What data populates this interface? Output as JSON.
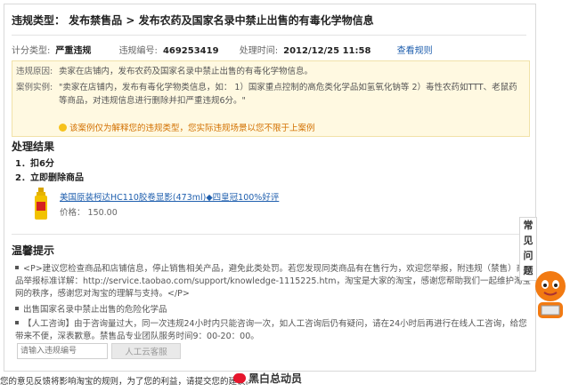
{
  "header": {
    "title": "违规类型： 发布禁售品 > 发布农药及国家名录中禁止出售的有毒化学物信息",
    "meta": {
      "score_type_label": "计分类型:",
      "score_type_value": "严重违规",
      "id_label": "违规编号:",
      "id_value": "469253419",
      "time_label": "处理时间:",
      "time_value": "2012/12/25 11:58",
      "rules_link": "查看规则"
    }
  },
  "reason": {
    "reason_label": "违规原因:",
    "reason_text": "卖家在店铺内，发布农药及国家名录中禁止出售的有毒化学物信息。",
    "example_label": "案例实例:",
    "example_text": "\"卖家在店铺内，发布有毒化学物类信息，如： 1）国家重点控制的高危类化学品如氢氧化钠等 2）毒性农药如TTT、老鼠药等商品，对违规信息进行删除并扣严重违规6分。\"",
    "tip": "该案例仅为解释您的违规类型，您实际违规场景以您不限于上案例"
  },
  "result": {
    "heading": "处理结果",
    "steps": [
      "1．扣6分",
      "2．立即删除商品"
    ],
    "product_name": "美国原装柯达HC110胶卷显影(473ml)◆四皇冠100%好评",
    "product_price": "价格： 150.00"
  },
  "tips": {
    "heading": "温馨提示",
    "items": [
      "<P>建议您检查商品和店铺信息，停止销售相关产品，避免此类处罚。若您发现同类商品有在售行为，欢迎您举报，附违规（禁售）商品举报标准详解：http://service.taobao.com/support/knowledge-1115225.htm，淘宝是大家的淘宝，感谢您帮助我们一起维护淘宝网的秩序，感谢您对淘宝的理解与支持。</P>",
      "出售国家名录中禁止出售的危险化学品",
      "【人工咨询】由于咨询量过大，同一次违规24小时内只能咨询一次，如人工咨询后仍有疑问，请在24小时后再进行在线人工咨询，给您带来不便，深表歉意。禁售品专业团队服务时间9：00-20：00。"
    ],
    "input_placeholder": "请输入违规编号",
    "consult_button": "人工云客服"
  },
  "faq": "常见问题",
  "footer": "您的意见反馈将影响淘宝的规则，为了您的利益，请提交您的建议。",
  "watermark": "黑白总动员",
  "colors": {
    "link": "#1f5fae",
    "reason_bg": "#fff9e1",
    "tip": "#d27000"
  }
}
